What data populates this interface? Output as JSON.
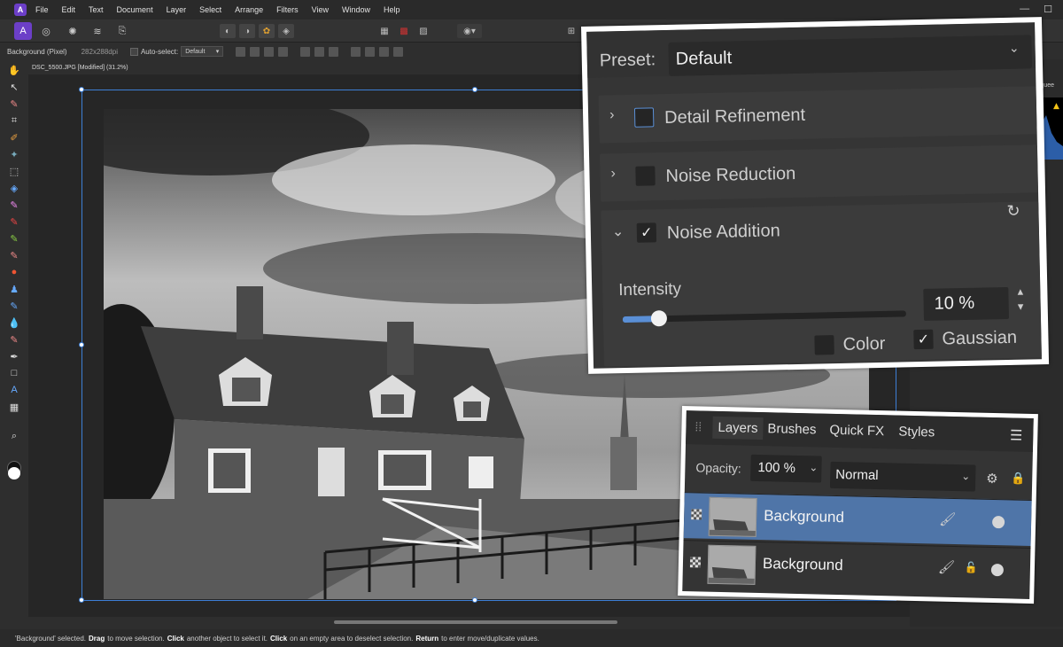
{
  "menubar": {
    "logo_letter": "A",
    "items": [
      "File",
      "Edit",
      "Text",
      "Document",
      "Layer",
      "Select",
      "Arrange",
      "Filters",
      "View",
      "Window",
      "Help"
    ],
    "window_controls": [
      "—",
      "☐"
    ]
  },
  "context_toolbar": {
    "layer_type": "Background (Pixel)",
    "dpi": "282x288dpi",
    "auto_select_label": "Auto-select:",
    "auto_select_value": "Default"
  },
  "document_tab": {
    "title": "DSC_5500.JPG [Modified] (31.2%)"
  },
  "right_dock": {
    "marquee_label": "Marquee"
  },
  "noise_panel": {
    "preset_label": "Preset:",
    "preset_value": "Default",
    "sections": [
      {
        "label": "Detail Refinement",
        "expanded": false,
        "enabled": false
      },
      {
        "label": "Noise Reduction",
        "expanded": false,
        "enabled": false
      },
      {
        "label": "Noise Addition",
        "expanded": true,
        "enabled": true
      }
    ],
    "intensity_label": "Intensity",
    "intensity_value_text": "10 %",
    "intensity_fraction": 0.1,
    "color_label": "Color",
    "color_checked": false,
    "gaussian_label": "Gaussian",
    "gaussian_checked": true
  },
  "layers_panel": {
    "tabs": [
      "Layers",
      "Brushes",
      "Quick FX",
      "Styles"
    ],
    "active_tab": "Layers",
    "opacity_label": "Opacity:",
    "opacity_value": "100 %",
    "blend_mode": "Normal",
    "layers": [
      {
        "name": "Background",
        "selected": true,
        "locked": false
      },
      {
        "name": "Background",
        "selected": false,
        "locked": true
      }
    ]
  },
  "statusbar": {
    "selected_text": "'Background' selected.",
    "drag": "Drag",
    "drag_text": "to move selection.",
    "click": "Click",
    "click_text": "another object to select it.",
    "click2": "Click",
    "click2_text": "on an empty area to deselect selection.",
    "return": "Return",
    "return_text": "to enter move/duplicate values."
  },
  "colors": {
    "accent_blue": "#4f75a8",
    "selection_blue": "#3d7fd6",
    "persona_purple": "#6c3fc8"
  }
}
